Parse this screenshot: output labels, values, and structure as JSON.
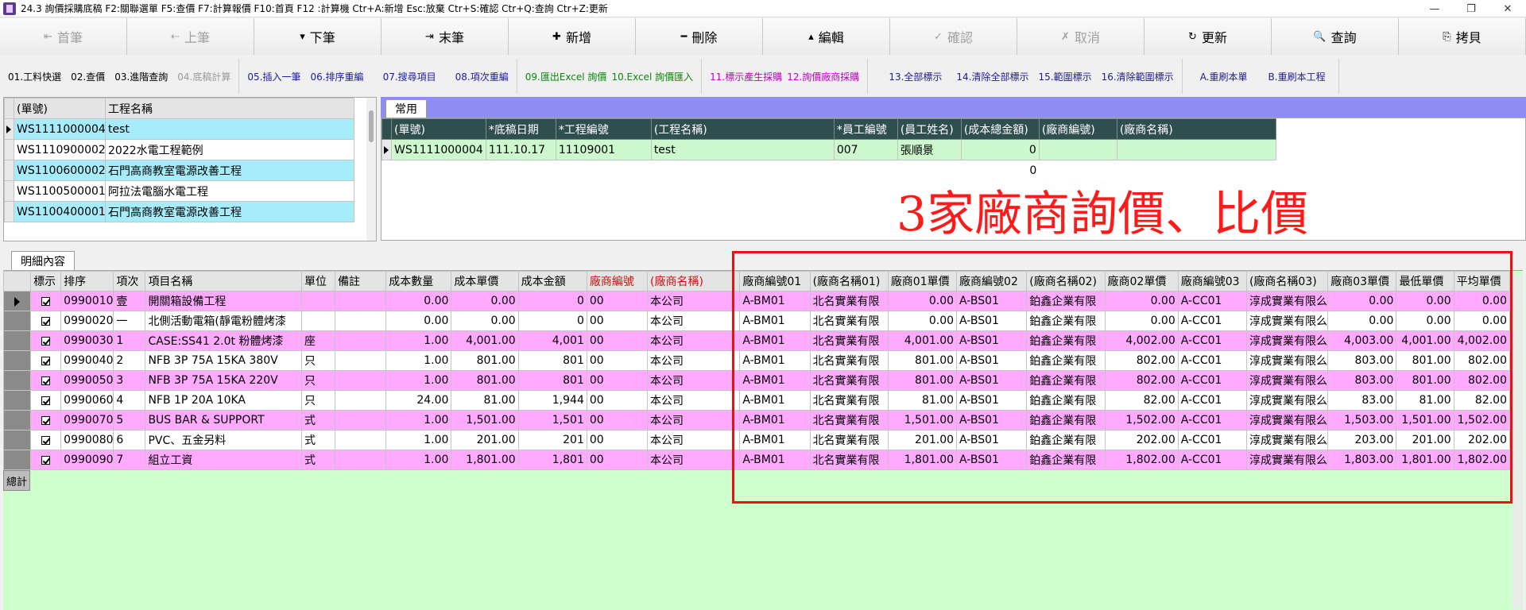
{
  "window": {
    "title": "24.3 詢價採購底稿   F2:關聯選單  F5:查價  F7:計算報價  F10:首頁  F12 :計算機  Ctr+A:新增  Esc:放棄  Ctr+S:確認  Ctr+Q:查詢  Ctr+Z:更新",
    "minimize": "—",
    "restore": "❐",
    "close": "✕"
  },
  "toolbar": [
    {
      "icon": "⇤",
      "label": "首筆",
      "enabled": false
    },
    {
      "icon": "⇠",
      "label": "上筆",
      "enabled": false
    },
    {
      "icon": "▾",
      "label": "下筆",
      "enabled": true
    },
    {
      "icon": "⇥",
      "label": "末筆",
      "enabled": true
    },
    {
      "icon": "✚",
      "label": "新增",
      "enabled": true
    },
    {
      "icon": "━",
      "label": "刪除",
      "enabled": true
    },
    {
      "icon": "▴",
      "label": "編輯",
      "enabled": true
    },
    {
      "icon": "✓",
      "label": "確認",
      "enabled": false
    },
    {
      "icon": "✗",
      "label": "取消",
      "enabled": false
    },
    {
      "icon": "↻",
      "label": "更新",
      "enabled": true
    },
    {
      "icon": "🔍",
      "label": "查詢",
      "enabled": true
    },
    {
      "icon": "⎘",
      "label": "拷貝",
      "enabled": true
    }
  ],
  "functions": {
    "g1": [
      "01.工料快選",
      "02.查價",
      "03.進階查詢",
      "04.底稿計算"
    ],
    "g2": [
      "05.插入一筆",
      "06.排序重編",
      "07.搜尋項目",
      "08.項次重編"
    ],
    "g3": [
      "09.匯出Excel 詢價",
      "10.Excel 詢價匯入"
    ],
    "g4": [
      "11.標示產生採購",
      "12.詢價廠商採購"
    ],
    "g5": [
      "13.全部標示",
      "14.清除全部標示",
      "15.範圍標示",
      "16.清除範圍標示"
    ],
    "g6": [
      "A.重刷本單",
      "B.重刷本工程"
    ]
  },
  "list": {
    "headers": [
      "(單號)",
      "工程名稱"
    ],
    "rows": [
      [
        "WS1111000004",
        "test"
      ],
      [
        "WS1110900002",
        "2022水電工程範例"
      ],
      [
        "WS1100600002",
        "石門高商教室電源改善工程"
      ],
      [
        "WS1100500001",
        "阿拉法電腦水電工程"
      ],
      [
        "WS1100400001",
        "石門高商教室電源改善工程"
      ]
    ]
  },
  "common_tab": {
    "label": "常用",
    "headers": [
      "(單號)",
      "*底稿日期",
      "*工程編號",
      "(工程名稱)",
      "*員工編號",
      "(員工姓名)",
      "(成本總金額)",
      "(廠商編號)",
      "(廠商名稱)"
    ],
    "row": [
      "WS1111000004",
      "111.10.17",
      "11109001",
      "test",
      "007",
      "張順景",
      "0",
      "",
      ""
    ],
    "total": "0"
  },
  "annotation": "3家廠商詢價、比價",
  "detail": {
    "tab_label": "明細內容",
    "headers": [
      "標示",
      "排序",
      "項次",
      "項目名稱",
      "單位",
      "備註",
      "成本數量",
      "成本單價",
      "成本金額",
      "廠商編號",
      "(廠商名稱)",
      "廠商編號01",
      "(廠商名稱01)",
      "廠商01單價",
      "廠商編號02",
      "(廠商名稱02)",
      "廠商02單價",
      "廠商編號03",
      "(廠商名稱03)",
      "廠商03單價",
      "最低單價",
      "平均單價"
    ],
    "rows": [
      [
        "",
        "0990010",
        "壹",
        "開關箱設備工程",
        "",
        "",
        "0.00",
        "0.00",
        "0",
        "00",
        "本公司",
        "A-BM01",
        "北名實業有限",
        "0.00",
        "A-BS01",
        "鉑鑫企業有限",
        "0.00",
        "A-CC01",
        "淳成實業有限么",
        "0.00",
        "0.00",
        "0.00"
      ],
      [
        "",
        "0990020",
        "一",
        "北側活動電箱(靜電粉體烤漆",
        "",
        "",
        "0.00",
        "0.00",
        "0",
        "00",
        "本公司",
        "A-BM01",
        "北名實業有限",
        "0.00",
        "A-BS01",
        "鉑鑫企業有限",
        "0.00",
        "A-CC01",
        "淳成實業有限么",
        "0.00",
        "0.00",
        "0.00"
      ],
      [
        "",
        "0990030",
        "1",
        "CASE:SS41 2.0t  粉體烤漆",
        "座",
        "",
        "1.00",
        "4,001.00",
        "4,001",
        "00",
        "本公司",
        "A-BM01",
        "北名實業有限",
        "4,001.00",
        "A-BS01",
        "鉑鑫企業有限",
        "4,002.00",
        "A-CC01",
        "淳成實業有限么",
        "4,003.00",
        "4,001.00",
        "4,002.00"
      ],
      [
        "",
        "0990040",
        "2",
        "NFB 3P 75A  15KA 380V",
        "只",
        "",
        "1.00",
        "801.00",
        "801",
        "00",
        "本公司",
        "A-BM01",
        "北名實業有限",
        "801.00",
        "A-BS01",
        "鉑鑫企業有限",
        "802.00",
        "A-CC01",
        "淳成實業有限么",
        "803.00",
        "801.00",
        "802.00"
      ],
      [
        "",
        "0990050",
        "3",
        "NFB 3P 75A  15KA 220V",
        "只",
        "",
        "1.00",
        "801.00",
        "801",
        "00",
        "本公司",
        "A-BM01",
        "北名實業有限",
        "801.00",
        "A-BS01",
        "鉑鑫企業有限",
        "802.00",
        "A-CC01",
        "淳成實業有限么",
        "803.00",
        "801.00",
        "802.00"
      ],
      [
        "",
        "0990060",
        "4",
        "NFB 1P 20A 10KA",
        "只",
        "",
        "24.00",
        "81.00",
        "1,944",
        "00",
        "本公司",
        "A-BM01",
        "北名實業有限",
        "81.00",
        "A-BS01",
        "鉑鑫企業有限",
        "82.00",
        "A-CC01",
        "淳成實業有限么",
        "83.00",
        "81.00",
        "82.00"
      ],
      [
        "",
        "0990070",
        "5",
        "BUS BAR & SUPPORT",
        "式",
        "",
        "1.00",
        "1,501.00",
        "1,501",
        "00",
        "本公司",
        "A-BM01",
        "北名實業有限",
        "1,501.00",
        "A-BS01",
        "鉑鑫企業有限",
        "1,502.00",
        "A-CC01",
        "淳成實業有限么",
        "1,503.00",
        "1,501.00",
        "1,502.00"
      ],
      [
        "",
        "0990080",
        "6",
        "PVC、五金另料",
        "式",
        "",
        "1.00",
        "201.00",
        "201",
        "00",
        "本公司",
        "A-BM01",
        "北名實業有限",
        "201.00",
        "A-BS01",
        "鉑鑫企業有限",
        "202.00",
        "A-CC01",
        "淳成實業有限么",
        "203.00",
        "201.00",
        "202.00"
      ],
      [
        "",
        "0990090",
        "7",
        "組立工資",
        "式",
        "",
        "1.00",
        "1,801.00",
        "1,801",
        "00",
        "本公司",
        "A-BM01",
        "北名實業有限",
        "1,801.00",
        "A-BS01",
        "鉑鑫企業有限",
        "1,802.00",
        "A-CC01",
        "淳成實業有限么",
        "1,803.00",
        "1,801.00",
        "1,802.00"
      ]
    ],
    "total_label": "總計"
  }
}
